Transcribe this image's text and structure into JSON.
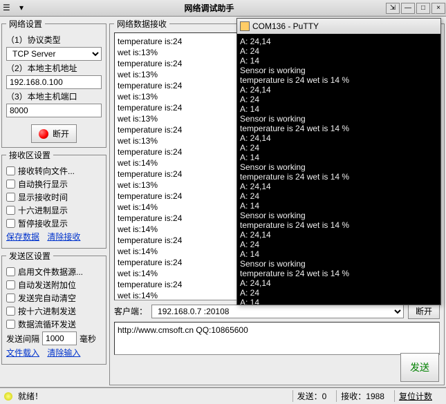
{
  "titlebar": {
    "title": "网络调试助手"
  },
  "net": {
    "legend": "网络设置",
    "protocol_label": "（1）协议类型",
    "protocol_value": "TCP Server",
    "host_label": "（2）本地主机地址",
    "host_value": "192.168.0.100",
    "port_label": "（3）本地主机端口",
    "port_value": "8000",
    "disconnect_label": "断开"
  },
  "recv_cfg": {
    "legend": "接收区设置",
    "redirect": "接收转向文件...",
    "autowrap": "自动换行显示",
    "showtime": "显示接收时间",
    "hex": "十六进制显示",
    "pause": "暂停接收显示",
    "save": "保存数据",
    "clear": "清除接收"
  },
  "send_cfg": {
    "legend": "发送区设置",
    "file_src": "启用文件数据源...",
    "auto_suffix": "自动发送附加位",
    "auto_clear": "发送完自动清空",
    "hex_send": "按十六进制发送",
    "loop_send": "数据流循环发送",
    "interval_label": "发送间隔",
    "interval_value": "1000",
    "interval_unit": "毫秒",
    "file_in": "文件载入",
    "clear_in": "清除输入"
  },
  "recv_data": {
    "legend": "网络数据接收",
    "lines": [
      "temperature is:24",
      "wet is:13%",
      "temperature is:24",
      "wet is:13%",
      "temperature is:24",
      "wet is:13%",
      "temperature is:24",
      "wet is:13%",
      "temperature is:24",
      "wet is:13%",
      "temperature is:24",
      "wet is:14%",
      "temperature is:24",
      "wet is:13%",
      "temperature is:24",
      "wet is:14%",
      "temperature is:24",
      "wet is:14%",
      "temperature is:24",
      "wet is:14%",
      "temperature is:24",
      "wet is:14%",
      "temperature is:24",
      "wet is:14%"
    ]
  },
  "client": {
    "label": "客户端：",
    "value": "192.168.0.7 :20108",
    "disconnect": "断开"
  },
  "sendbox": {
    "text": "http://www.cmsoft.cn QQ:10865600",
    "send_btn": "发送"
  },
  "status": {
    "ready": "就绪！",
    "send_label": "发送：",
    "send_count": "0",
    "recv_label": "接收：",
    "recv_count": "1988",
    "reset": "复位计数"
  },
  "putty": {
    "title": "COM136 - PuTTY",
    "lines": [
      "A: 24,14",
      "A: 24",
      "A: 14",
      "Sensor is working",
      "temperature is 24 wet is 14 %",
      "A: 24,14",
      "A: 24",
      "A: 14",
      "Sensor is working",
      "temperature is 24 wet is 14 %",
      "A: 24,14",
      "A: 24",
      "A: 14",
      "Sensor is working",
      "temperature is 24 wet is 14 %",
      "A: 24,14",
      "A: 24",
      "A: 14",
      "Sensor is working",
      "temperature is 24 wet is 14 %",
      "A: 24,14",
      "A: 24",
      "A: 14",
      "Sensor is working",
      "temperature is 24 wet is 14 %",
      "A: 24,14",
      "A: 24",
      "A: 14"
    ]
  }
}
